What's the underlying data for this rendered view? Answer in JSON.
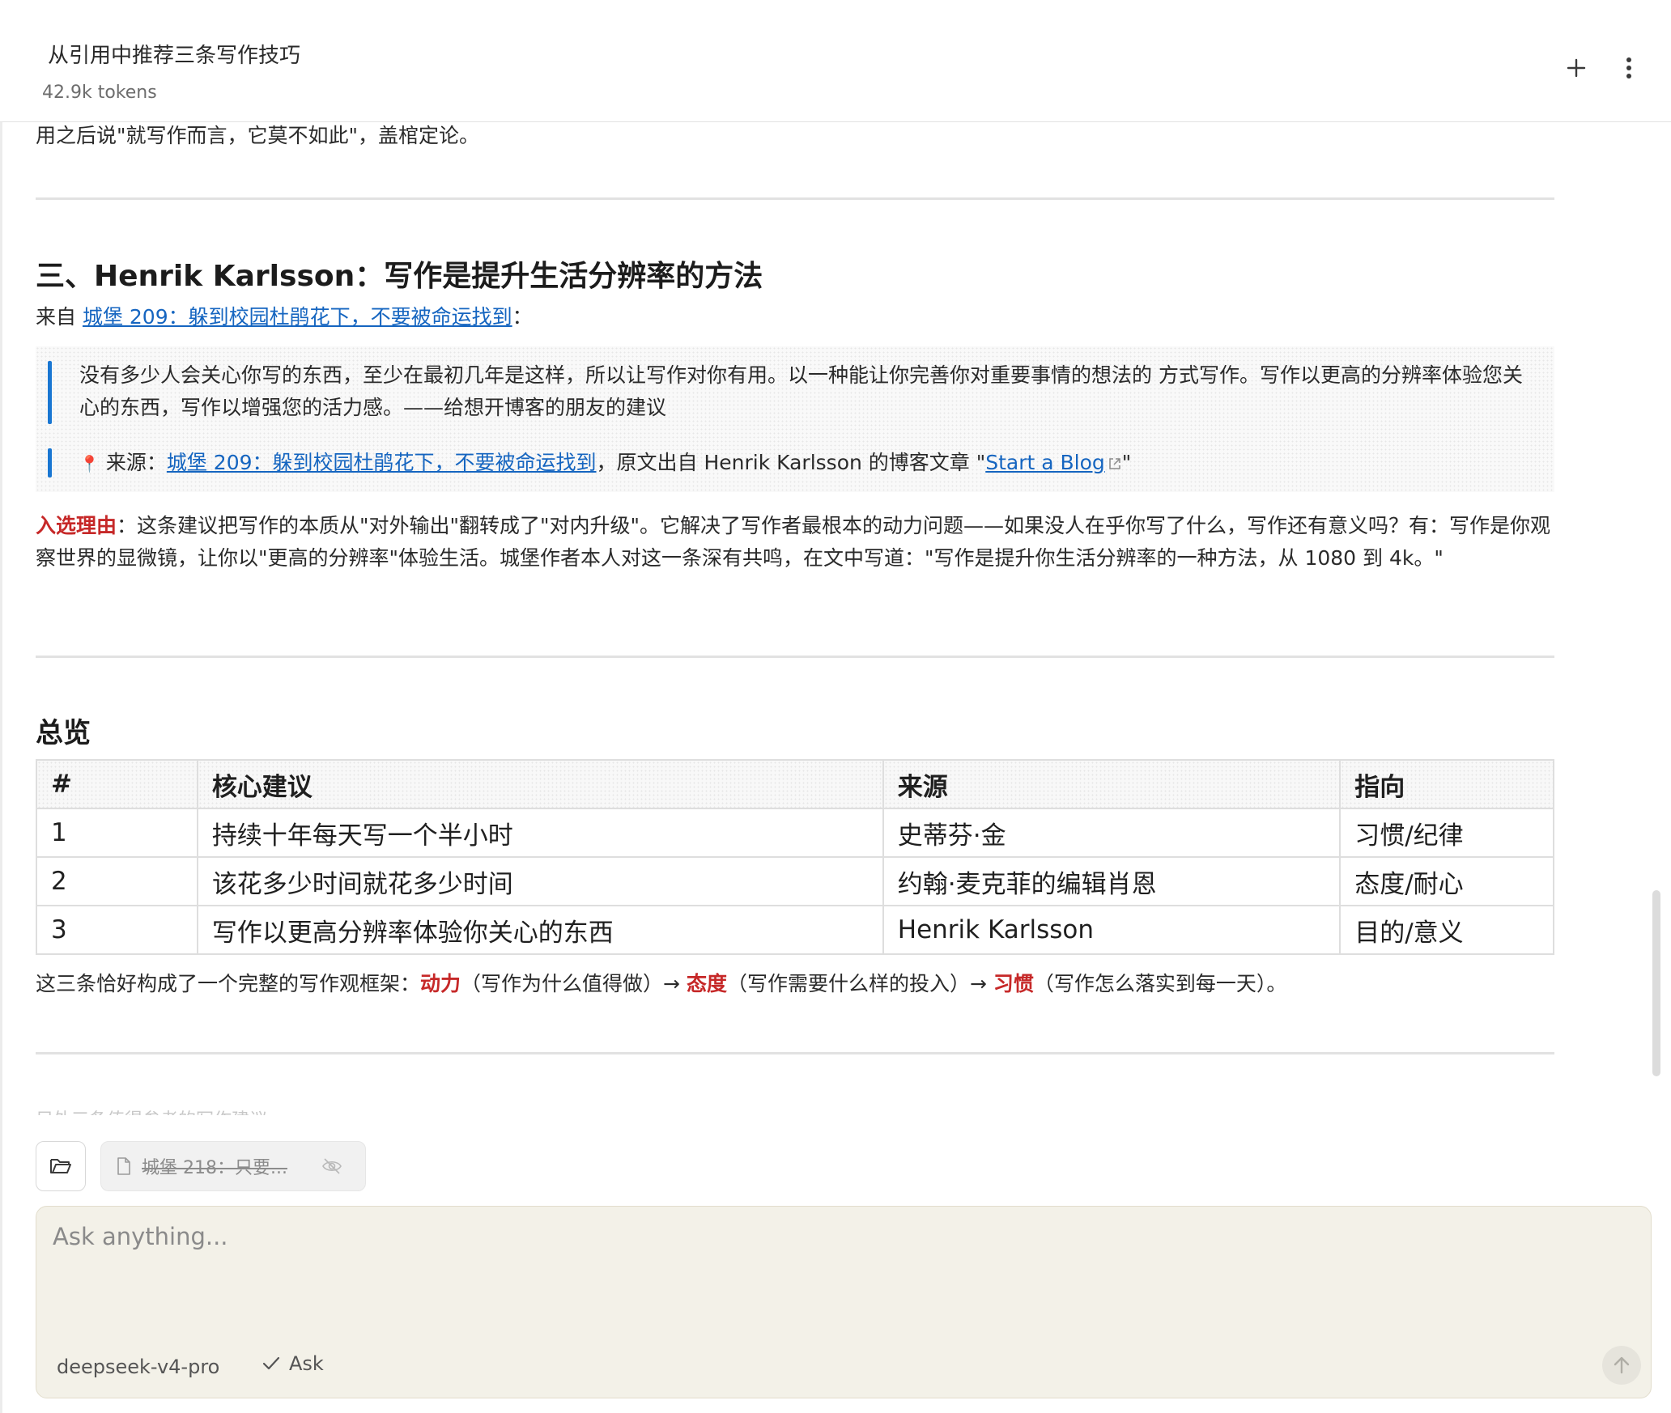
{
  "header": {
    "title": "从引用中推荐三条写作技巧",
    "tokens": "42.9k tokens"
  },
  "clipped_line": "用之后说\"就写作而言，它莫不如此\"，盖棺定论。",
  "section3": {
    "heading": "三、Henrik Karlsson：写作是提升生活分辨率的方法",
    "source_prefix": "来自 ",
    "source_link": "城堡 209：躲到校园杜鹃花下，不要被命运找到",
    "source_suffix": "：",
    "quote": "没有多少人会关心你写的东西，至少在最初几年是这样，所以让写作对你有用。以一种能让你完善你对重要事情的想法的 方式写作。写作以更高的分辨率体验您关心的东西，写作以增强您的活力感。——给想开博客的朋友的建议",
    "citation_icon": "📍",
    "citation_prefix": " 来源：",
    "citation_link": "城堡 209：躲到校园杜鹃花下，不要被命运找到",
    "citation_middle": "，原文出自 Henrik Karlsson 的博客文章 \"",
    "citation_ext_link": "Start a Blog",
    "citation_end": "\"",
    "reason_label": "入选理由",
    "reason_text": "：这条建议把写作的本质从\"对外输出\"翻转成了\"对内升级\"。它解决了写作者最根本的动力问题——如果没人在乎你写了什么，写作还有意义吗？有：写作是你观察世界的显微镜，让你以\"更高的分辨率\"体验生活。城堡作者本人对这一条深有共鸣，在文中写道：\"写作是提升你生活分辨率的一种方法，从 1080 到 4k。\""
  },
  "overview": {
    "heading": "总览",
    "columns": [
      "#",
      "核心建议",
      "来源",
      "指向"
    ],
    "rows": [
      [
        "1",
        "持续十年每天写一个半小时",
        "史蒂芬·金",
        "习惯/纪律"
      ],
      [
        "2",
        "该花多少时间就花多少时间",
        "约翰·麦克菲的编辑肖恩",
        "态度/耐心"
      ],
      [
        "3",
        "写作以更高分辨率体验你关心的东西",
        "Henrik Karlsson",
        "目的/意义"
      ]
    ],
    "summary_prefix": "这三条恰好构成了一个完整的写作观框架：",
    "k1": "动力",
    "t1": "（写作为什么值得做）→ ",
    "k2": "态度",
    "t2": "（写作需要什么样的投入）→ ",
    "k3": "习惯",
    "t3": "（写作怎么落实到每一天）。"
  },
  "faded_text": "另外三条值得参考的写作建议",
  "composer": {
    "file_chip": "城堡 218：只要...",
    "placeholder": "Ask anything...",
    "model": "deepseek-v4-pro",
    "mode": "Ask"
  }
}
